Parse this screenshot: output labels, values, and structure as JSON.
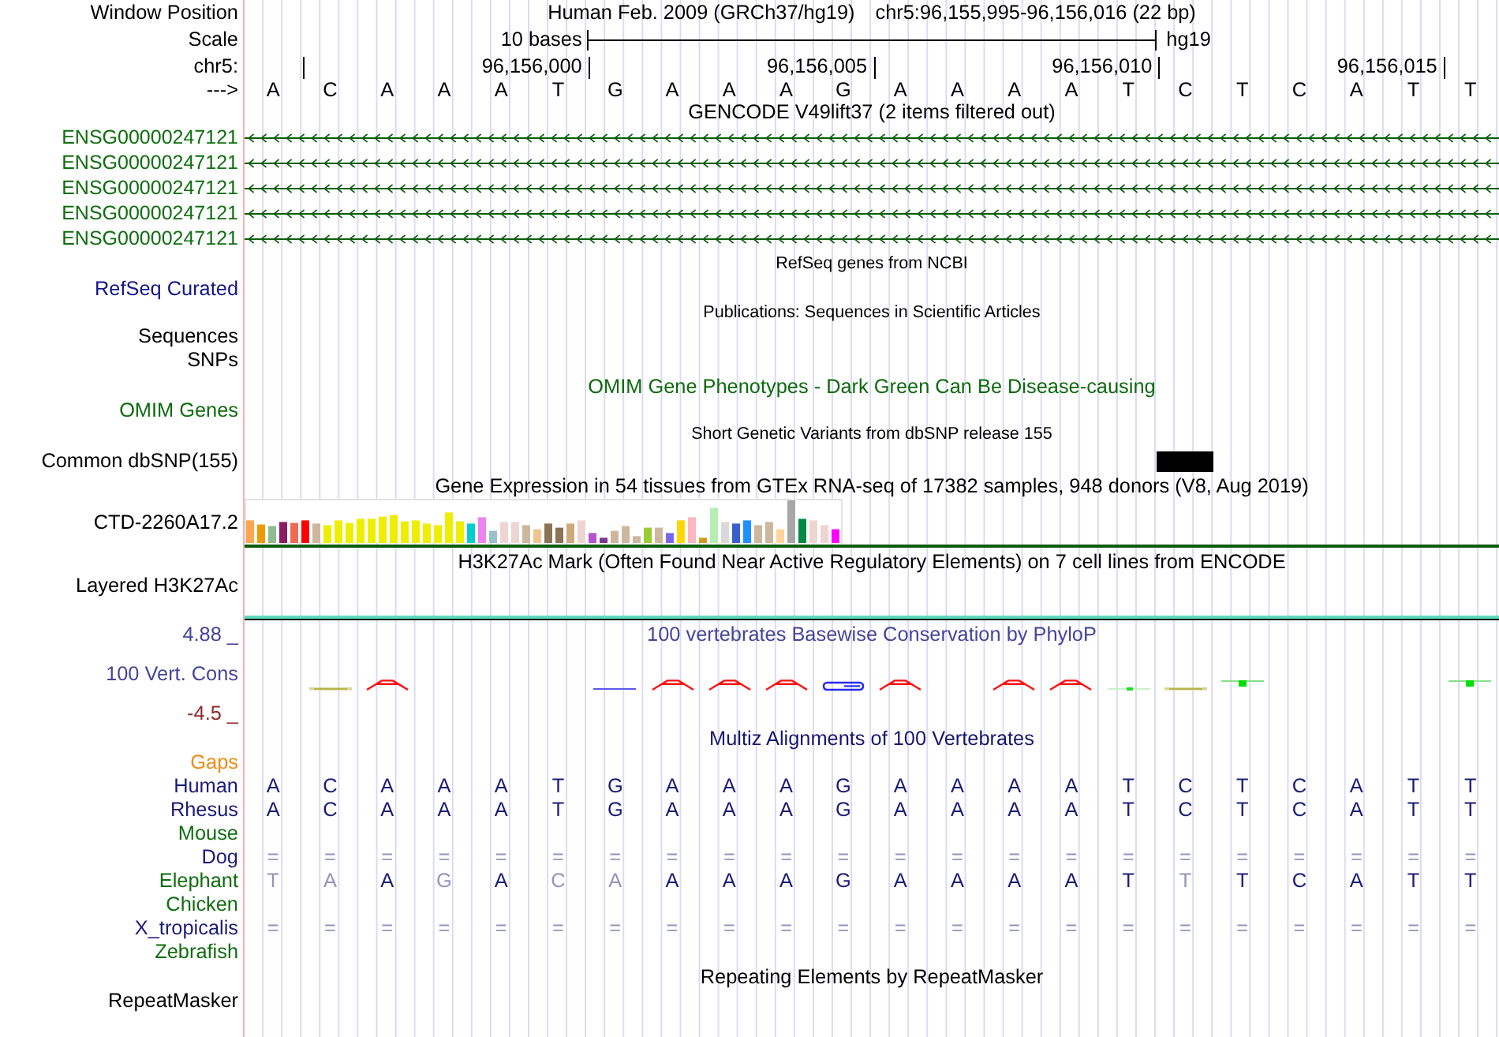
{
  "header": {
    "label": "Window Position",
    "assembly": "Human Feb. 2009 (GRCh37/hg19)",
    "range": "chr5:96,155,995-96,156,016 (22 bp)"
  },
  "scale": {
    "label": "Scale",
    "span": "10 bases",
    "assembly": "hg19"
  },
  "ruler": {
    "label": "chr5:",
    "ticks": [
      "96,156,000",
      "96,156,005",
      "96,156,010",
      "96,156,015"
    ]
  },
  "sequence": {
    "label": "--->",
    "bases": [
      "A",
      "C",
      "A",
      "A",
      "A",
      "T",
      "G",
      "A",
      "A",
      "A",
      "G",
      "A",
      "A",
      "A",
      "A",
      "T",
      "C",
      "T",
      "C",
      "A",
      "T",
      "T"
    ]
  },
  "gencode": {
    "title": "GENCODE V49lift37 (2 items filtered out)",
    "genes": [
      "ENSG00000247121",
      "ENSG00000247121",
      "ENSG00000247121",
      "ENSG00000247121",
      "ENSG00000247121"
    ]
  },
  "refseq": {
    "title": "RefSeq genes from NCBI",
    "label": "RefSeq Curated"
  },
  "publications": {
    "title": "Publications: Sequences in Scientific Articles",
    "labels": [
      "Sequences",
      "SNPs"
    ]
  },
  "omim": {
    "title": "OMIM Gene Phenotypes - Dark Green Can Be Disease-causing",
    "label": "OMIM Genes"
  },
  "dbsnp": {
    "title": "Short Genetic Variants from dbSNP release 155",
    "label": "Common dbSNP(155)"
  },
  "gtex": {
    "title": "Gene Expression in 54 tissues from GTEx RNA-seq of 17382 samples, 948 donors (V8, Aug 2019)",
    "label": "CTD-2260A17.2"
  },
  "h3k27ac": {
    "title": "H3K27Ac Mark (Often Found Near Active Regulatory Elements) on 7 cell lines from ENCODE",
    "label": "Layered H3K27Ac"
  },
  "phylop": {
    "title": "100 vertebrates Basewise Conservation by PhyloP",
    "label": "100 Vert. Cons",
    "axis_max": "4.88 _",
    "axis_min": "-4.5 _"
  },
  "multiz": {
    "title": "Multiz Alignments of 100 Vertebrates",
    "rows": [
      {
        "name": "Gaps",
        "color": "#ec8c14"
      },
      {
        "name": "Human",
        "color": "#1b1b78",
        "cells": [
          {
            "text": "A",
            "dim": false
          },
          {
            "text": "C",
            "dim": false
          },
          {
            "text": "A",
            "dim": false
          },
          {
            "text": "A",
            "dim": false
          },
          {
            "text": "A",
            "dim": false
          },
          {
            "text": "T",
            "dim": false
          },
          {
            "text": "G",
            "dim": false
          },
          {
            "text": "A",
            "dim": false
          },
          {
            "text": "A",
            "dim": false
          },
          {
            "text": "A",
            "dim": false
          },
          {
            "text": "G",
            "dim": false
          },
          {
            "text": "A",
            "dim": false
          },
          {
            "text": "A",
            "dim": false
          },
          {
            "text": "A",
            "dim": false
          },
          {
            "text": "A",
            "dim": false
          },
          {
            "text": "T",
            "dim": false
          },
          {
            "text": "C",
            "dim": false
          },
          {
            "text": "T",
            "dim": false
          },
          {
            "text": "C",
            "dim": false
          },
          {
            "text": "A",
            "dim": false
          },
          {
            "text": "T",
            "dim": false
          },
          {
            "text": "T",
            "dim": false
          }
        ]
      },
      {
        "name": "Rhesus",
        "color": "#1b1b78",
        "cells": [
          {
            "text": "A",
            "dim": false
          },
          {
            "text": "C",
            "dim": false
          },
          {
            "text": "A",
            "dim": false
          },
          {
            "text": "A",
            "dim": false
          },
          {
            "text": "A",
            "dim": false
          },
          {
            "text": "T",
            "dim": false
          },
          {
            "text": "G",
            "dim": false
          },
          {
            "text": "A",
            "dim": false
          },
          {
            "text": "A",
            "dim": false
          },
          {
            "text": "A",
            "dim": false
          },
          {
            "text": "G",
            "dim": false
          },
          {
            "text": "A",
            "dim": false
          },
          {
            "text": "A",
            "dim": false
          },
          {
            "text": "A",
            "dim": false
          },
          {
            "text": "A",
            "dim": false
          },
          {
            "text": "T",
            "dim": false
          },
          {
            "text": "C",
            "dim": false
          },
          {
            "text": "T",
            "dim": false
          },
          {
            "text": "C",
            "dim": false
          },
          {
            "text": "A",
            "dim": false
          },
          {
            "text": "T",
            "dim": false
          },
          {
            "text": "T",
            "dim": false
          }
        ]
      },
      {
        "name": "Mouse",
        "color": "#0f6e0f"
      },
      {
        "name": "Dog",
        "color": "#1b1b78",
        "cells": [
          {
            "text": "=",
            "dim": true
          },
          {
            "text": "=",
            "dim": true
          },
          {
            "text": "=",
            "dim": true
          },
          {
            "text": "=",
            "dim": true
          },
          {
            "text": "=",
            "dim": true
          },
          {
            "text": "=",
            "dim": true
          },
          {
            "text": "=",
            "dim": true
          },
          {
            "text": "=",
            "dim": true
          },
          {
            "text": "=",
            "dim": true
          },
          {
            "text": "=",
            "dim": true
          },
          {
            "text": "=",
            "dim": true
          },
          {
            "text": "=",
            "dim": true
          },
          {
            "text": "=",
            "dim": true
          },
          {
            "text": "=",
            "dim": true
          },
          {
            "text": "=",
            "dim": true
          },
          {
            "text": "=",
            "dim": true
          },
          {
            "text": "=",
            "dim": true
          },
          {
            "text": "=",
            "dim": true
          },
          {
            "text": "=",
            "dim": true
          },
          {
            "text": "=",
            "dim": true
          },
          {
            "text": "=",
            "dim": true
          },
          {
            "text": "=",
            "dim": true
          }
        ]
      },
      {
        "name": "Elephant",
        "color": "#0f6e0f",
        "cells": [
          {
            "text": "T",
            "dim": true
          },
          {
            "text": "A",
            "dim": true
          },
          {
            "text": "A",
            "dim": false
          },
          {
            "text": "G",
            "dim": true
          },
          {
            "text": "A",
            "dim": false
          },
          {
            "text": "C",
            "dim": true
          },
          {
            "text": "A",
            "dim": true
          },
          {
            "text": "A",
            "dim": false
          },
          {
            "text": "A",
            "dim": false
          },
          {
            "text": "A",
            "dim": false
          },
          {
            "text": "G",
            "dim": false
          },
          {
            "text": "A",
            "dim": false
          },
          {
            "text": "A",
            "dim": false
          },
          {
            "text": "A",
            "dim": false
          },
          {
            "text": "A",
            "dim": false
          },
          {
            "text": "T",
            "dim": false
          },
          {
            "text": "T",
            "dim": true
          },
          {
            "text": "T",
            "dim": false
          },
          {
            "text": "C",
            "dim": false
          },
          {
            "text": "A",
            "dim": false
          },
          {
            "text": "T",
            "dim": false
          },
          {
            "text": "T",
            "dim": false
          }
        ]
      },
      {
        "name": "Chicken",
        "color": "#0f6e0f"
      },
      {
        "name": "X_tropicalis",
        "color": "#1b1b78",
        "cells": [
          {
            "text": "=",
            "dim": true
          },
          {
            "text": "=",
            "dim": true
          },
          {
            "text": "=",
            "dim": true
          },
          {
            "text": "=",
            "dim": true
          },
          {
            "text": "=",
            "dim": true
          },
          {
            "text": "=",
            "dim": true
          },
          {
            "text": "=",
            "dim": true
          },
          {
            "text": "=",
            "dim": true
          },
          {
            "text": "=",
            "dim": true
          },
          {
            "text": "=",
            "dim": true
          },
          {
            "text": "=",
            "dim": true
          },
          {
            "text": "=",
            "dim": true
          },
          {
            "text": "=",
            "dim": true
          },
          {
            "text": "=",
            "dim": true
          },
          {
            "text": "=",
            "dim": true
          },
          {
            "text": "=",
            "dim": true
          },
          {
            "text": "=",
            "dim": true
          },
          {
            "text": "=",
            "dim": true
          },
          {
            "text": "=",
            "dim": true
          },
          {
            "text": "=",
            "dim": true
          },
          {
            "text": "=",
            "dim": true
          },
          {
            "text": "=",
            "dim": true
          }
        ]
      },
      {
        "name": "Zebrafish",
        "color": "#0f6e0f"
      }
    ]
  },
  "repeatmasker": {
    "title": "Repeating Elements by RepeatMasker",
    "label": "RepeatMasker"
  }
}
